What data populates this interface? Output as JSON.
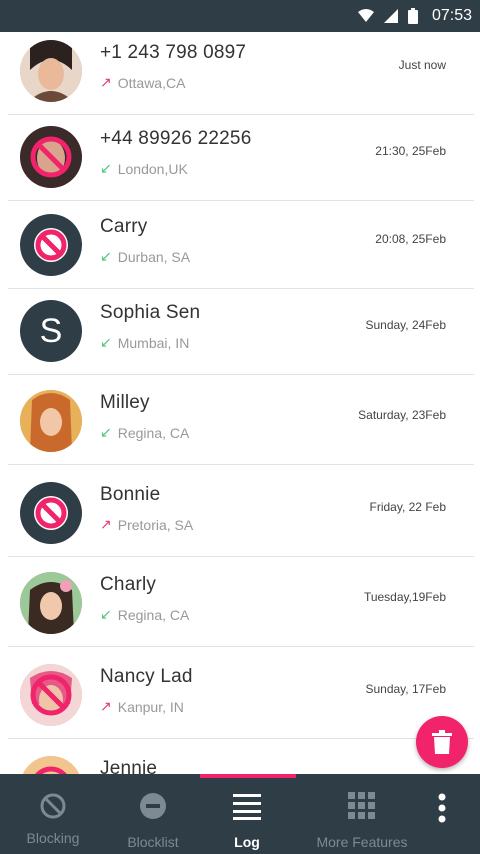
{
  "status_bar": {
    "time": "07:53"
  },
  "calls": [
    {
      "name": "+1 243 798 0897",
      "location": "Ottawa,CA",
      "direction": "outgoing",
      "time": "Just now",
      "avatar": "photo"
    },
    {
      "name": "+44  89926 22256",
      "location": "London,UK",
      "direction": "incoming",
      "time": "21:30, 25Feb",
      "avatar": "blocked-photo"
    },
    {
      "name": "Carry",
      "location": "Durban, SA",
      "direction": "incoming",
      "time": "20:08, 25Feb",
      "avatar": "blocked"
    },
    {
      "name": "Sophia Sen",
      "location": "Mumbai, IN",
      "direction": "incoming",
      "time": "Sunday, 24Feb",
      "avatar": "letter",
      "letter": "S"
    },
    {
      "name": "Milley",
      "location": "Regina, CA",
      "direction": "incoming",
      "time": "Saturday, 23Feb",
      "avatar": "photo"
    },
    {
      "name": "Bonnie",
      "location": "Pretoria, SA",
      "direction": "outgoing",
      "time": "Friday, 22 Feb",
      "avatar": "blocked"
    },
    {
      "name": "Charly",
      "location": "Regina, CA",
      "direction": "incoming",
      "time": "Tuesday,19Feb",
      "avatar": "photo"
    },
    {
      "name": "Nancy Lad",
      "location": "Kanpur, IN",
      "direction": "outgoing",
      "time": "Sunday, 17Feb",
      "avatar": "blocked-photo"
    },
    {
      "name": "Jennie",
      "location": "",
      "direction": "",
      "time": "",
      "avatar": "blocked-photo"
    }
  ],
  "fab": {
    "icon": "trash-icon"
  },
  "nav": {
    "items": [
      {
        "label": "Blocking",
        "icon": "block-icon"
      },
      {
        "label": "Blocklist",
        "icon": "minus-circle-icon"
      },
      {
        "label": "Log",
        "icon": "list-icon"
      },
      {
        "label": "More Features",
        "icon": "grid-icon"
      }
    ],
    "overflow_icon": "more-vertical-icon"
  },
  "colors": {
    "primary": "#2f3d47",
    "accent": "#f0236b",
    "incoming": "#4fc67a",
    "outgoing": "#e53b6d"
  }
}
